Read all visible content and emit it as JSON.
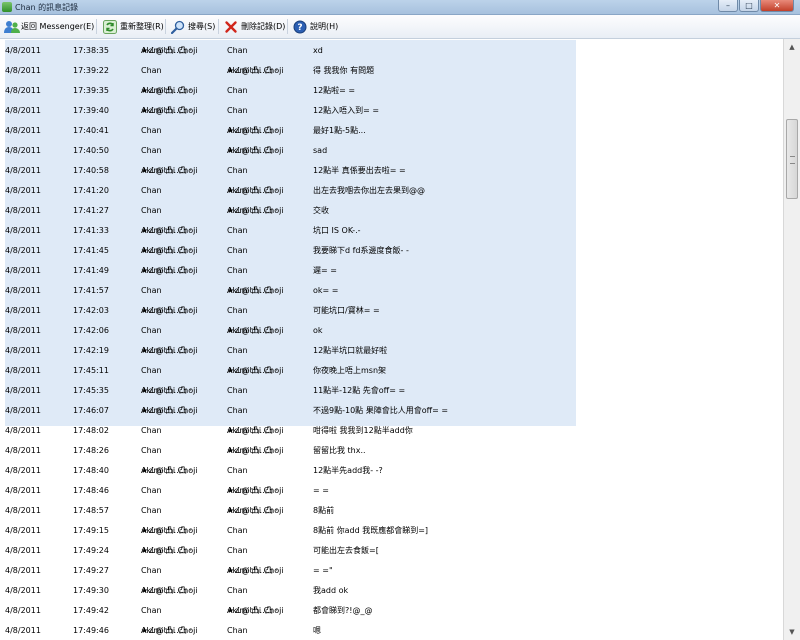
{
  "window": {
    "title": "Chan 的訊息記錄",
    "controls": {
      "minimize": "–",
      "maximize": "□",
      "close": "✕"
    }
  },
  "toolbar": {
    "back_label": "返回 Messenger(E)",
    "refresh_label": "重新整理(R)",
    "search_label": "搜尋(S)",
    "delete_label": "刪除記錄(D)",
    "help_label": "說明(H)"
  },
  "contacts": {
    "me_line1": "★∠@'凸‥凸 ·",
    "me_line2": "Akimichi Choji",
    "other": "Chan"
  },
  "selected_rows_count": 19,
  "messages": [
    {
      "date": "4/8/2011",
      "time": "17:38:35",
      "from": "me",
      "to": "other",
      "text": "xd"
    },
    {
      "date": "4/8/2011",
      "time": "17:39:22",
      "from": "other",
      "to": "me",
      "text": "得 我我你 有問題"
    },
    {
      "date": "4/8/2011",
      "time": "17:39:35",
      "from": "me",
      "to": "other",
      "text": "12點啦= ="
    },
    {
      "date": "4/8/2011",
      "time": "17:39:40",
      "from": "me",
      "to": "other",
      "text": "12點入唔入到= ="
    },
    {
      "date": "4/8/2011",
      "time": "17:40:41",
      "from": "other",
      "to": "me",
      "text": "最好1點-5點..."
    },
    {
      "date": "4/8/2011",
      "time": "17:40:50",
      "from": "other",
      "to": "me",
      "text": "sad"
    },
    {
      "date": "4/8/2011",
      "time": "17:40:58",
      "from": "me",
      "to": "other",
      "text": "12點半 真係要出去啦= ="
    },
    {
      "date": "4/8/2011",
      "time": "17:41:20",
      "from": "other",
      "to": "me",
      "text": "出左去我嗰去你出左去果到@@"
    },
    {
      "date": "4/8/2011",
      "time": "17:41:27",
      "from": "other",
      "to": "me",
      "text": "交收"
    },
    {
      "date": "4/8/2011",
      "time": "17:41:33",
      "from": "me",
      "to": "other",
      "text": "坑口 IS OK-.-"
    },
    {
      "date": "4/8/2011",
      "time": "17:41:45",
      "from": "me",
      "to": "other",
      "text": "我要睇下d fd系邊度食飯- -"
    },
    {
      "date": "4/8/2011",
      "time": "17:41:49",
      "from": "me",
      "to": "other",
      "text": "遲= ="
    },
    {
      "date": "4/8/2011",
      "time": "17:41:57",
      "from": "other",
      "to": "me",
      "text": "ok= ="
    },
    {
      "date": "4/8/2011",
      "time": "17:42:03",
      "from": "me",
      "to": "other",
      "text": "可能坑口/寶林= ="
    },
    {
      "date": "4/8/2011",
      "time": "17:42:06",
      "from": "other",
      "to": "me",
      "text": "ok"
    },
    {
      "date": "4/8/2011",
      "time": "17:42:19",
      "from": "me",
      "to": "other",
      "text": "12點半坑口就最好啦"
    },
    {
      "date": "4/8/2011",
      "time": "17:45:11",
      "from": "other",
      "to": "me",
      "text": "你夜晚上唔上msn架"
    },
    {
      "date": "4/8/2011",
      "time": "17:45:35",
      "from": "me",
      "to": "other",
      "text": "11點半-12點 先會off= ="
    },
    {
      "date": "4/8/2011",
      "time": "17:46:07",
      "from": "me",
      "to": "other",
      "text": "不過9點-10點 果陣會比人用會off= ="
    },
    {
      "date": "4/8/2011",
      "time": "17:48:02",
      "from": "other",
      "to": "me",
      "text": "咁得啦 我我到12點半add你"
    },
    {
      "date": "4/8/2011",
      "time": "17:48:26",
      "from": "other",
      "to": "me",
      "text": "留留比我 thx.."
    },
    {
      "date": "4/8/2011",
      "time": "17:48:40",
      "from": "me",
      "to": "other",
      "text": "12點半先add我- -?"
    },
    {
      "date": "4/8/2011",
      "time": "17:48:46",
      "from": "other",
      "to": "me",
      "text": "= ="
    },
    {
      "date": "4/8/2011",
      "time": "17:48:57",
      "from": "other",
      "to": "me",
      "text": "8點前"
    },
    {
      "date": "4/8/2011",
      "time": "17:49:15",
      "from": "me",
      "to": "other",
      "text": "8點前 你add 我既應都會睇到=]"
    },
    {
      "date": "4/8/2011",
      "time": "17:49:24",
      "from": "me",
      "to": "other",
      "text": "可能出左去食飯=["
    },
    {
      "date": "4/8/2011",
      "time": "17:49:27",
      "from": "other",
      "to": "me",
      "text": "= =\""
    },
    {
      "date": "4/8/2011",
      "time": "17:49:30",
      "from": "me",
      "to": "other",
      "text": "我add ok"
    },
    {
      "date": "4/8/2011",
      "time": "17:49:42",
      "from": "other",
      "to": "me",
      "text": "都會睇到?!@_@"
    },
    {
      "date": "4/8/2011",
      "time": "17:49:46",
      "from": "me",
      "to": "other",
      "text": "嗯"
    }
  ]
}
